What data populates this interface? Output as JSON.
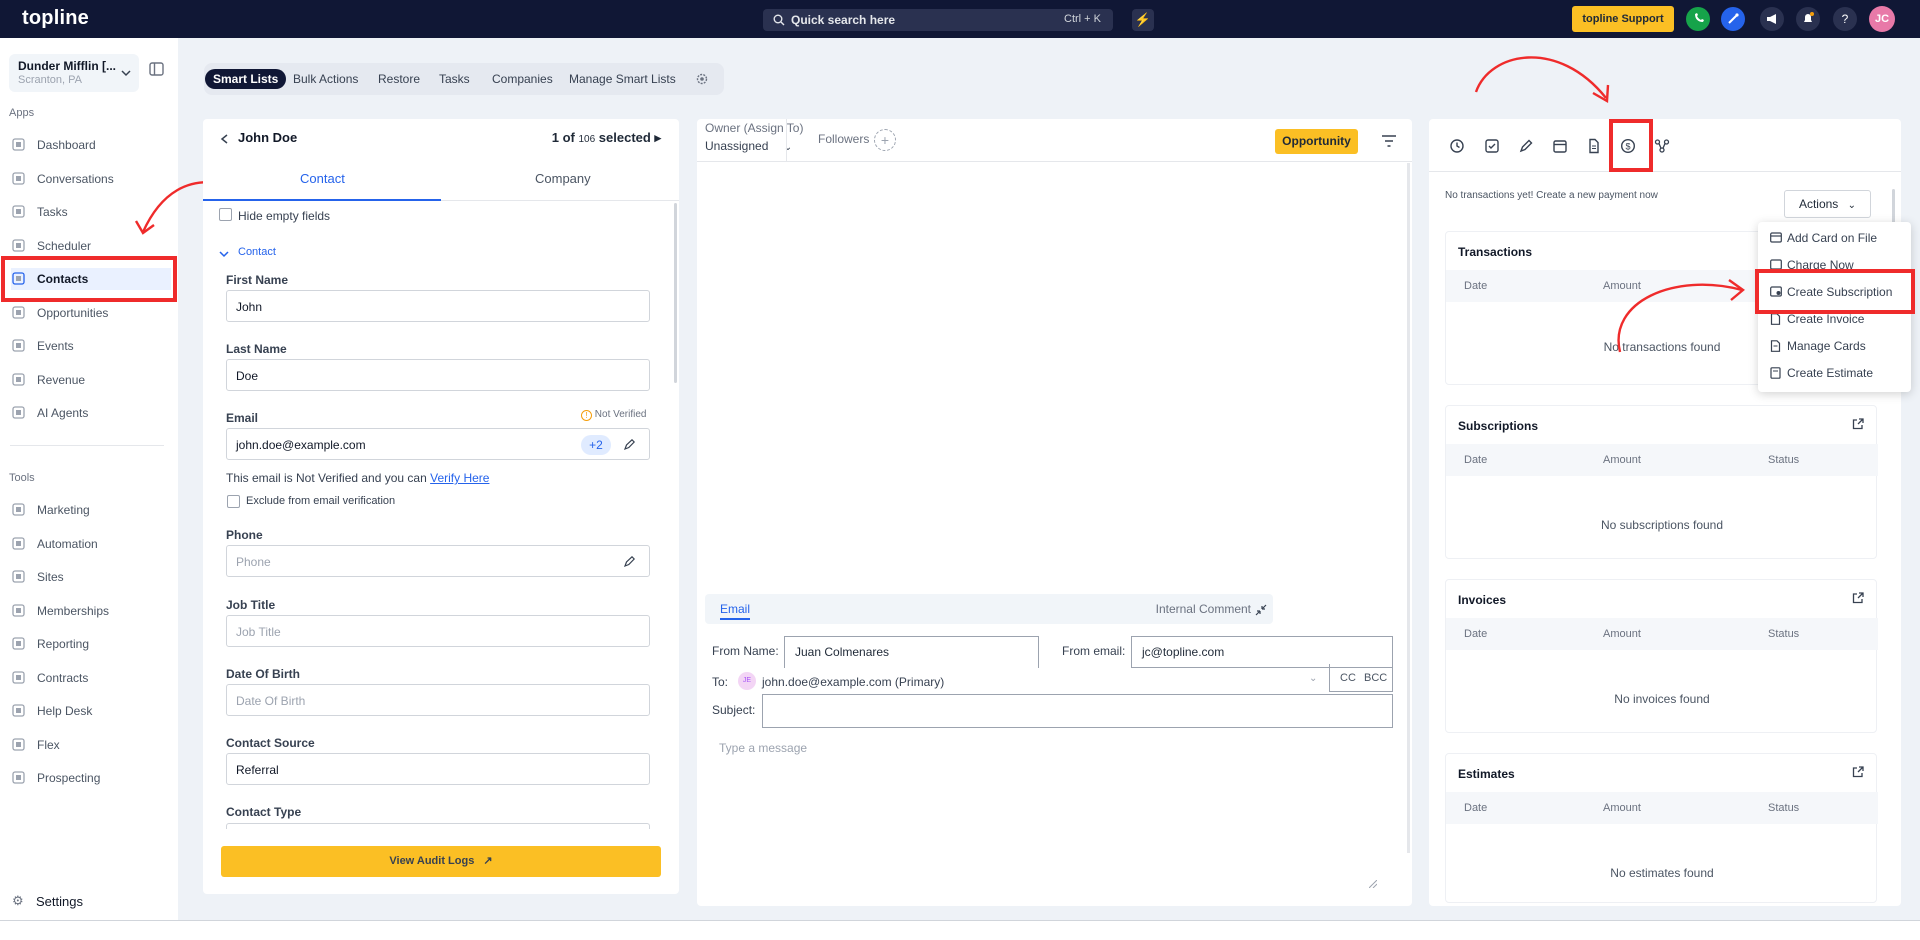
{
  "topbar": {
    "logo": "topline",
    "search_placeholder": "Quick search here",
    "search_shortcut": "Ctrl + K",
    "support_label": "topline Support",
    "avatar_initials": "JC"
  },
  "sidebar": {
    "location_name": "Dunder Mifflin [...",
    "location_city": "Scranton, PA",
    "apps_heading": "Apps",
    "apps": [
      {
        "label": "Dashboard",
        "icon": "dashboard-icon"
      },
      {
        "label": "Conversations",
        "icon": "chat-icon"
      },
      {
        "label": "Tasks",
        "icon": "tasks-icon"
      },
      {
        "label": "Scheduler",
        "icon": "calendar-icon"
      },
      {
        "label": "Contacts",
        "icon": "user-icon"
      },
      {
        "label": "Opportunities",
        "icon": "opportunities-icon"
      },
      {
        "label": "Events",
        "icon": "events-icon"
      },
      {
        "label": "Revenue",
        "icon": "revenue-icon"
      },
      {
        "label": "AI Agents",
        "icon": "sparkle-icon"
      }
    ],
    "tools_heading": "Tools",
    "tools": [
      {
        "label": "Marketing",
        "icon": "megaphone-icon"
      },
      {
        "label": "Automation",
        "icon": "automation-icon"
      },
      {
        "label": "Sites",
        "icon": "sites-icon"
      },
      {
        "label": "Memberships",
        "icon": "memberships-icon"
      },
      {
        "label": "Reporting",
        "icon": "reporting-icon"
      },
      {
        "label": "Contracts",
        "icon": "contracts-icon"
      },
      {
        "label": "Help Desk",
        "icon": "helpdesk-icon"
      },
      {
        "label": "Flex",
        "icon": "flex-icon"
      },
      {
        "label": "Prospecting",
        "icon": "prospecting-icon"
      }
    ],
    "settings_label": "Settings"
  },
  "tabs_bar": {
    "items": [
      "Smart Lists",
      "Bulk Actions",
      "Restore",
      "Tasks",
      "Companies",
      "Manage Smart Lists"
    ]
  },
  "contact_panel": {
    "name": "John Doe",
    "selected_prefix": "1 of",
    "selected_total": "106",
    "selected_suffix": "selected",
    "tab_contact": "Contact",
    "tab_company": "Company",
    "hide_empty": "Hide empty fields",
    "section": "Contact",
    "first_name_label": "First Name",
    "first_name": "John",
    "last_name_label": "Last Name",
    "last_name": "Doe",
    "email_label": "Email",
    "not_verified": "Not Verified",
    "email": "john.doe@example.com",
    "email_extra": "+2",
    "verify_text": "This email is Not Verified and you can",
    "verify_link": "Verify Here",
    "exclude_label": "Exclude from email verification",
    "phone_label": "Phone",
    "phone_placeholder": "Phone",
    "job_title_label": "Job Title",
    "job_title_placeholder": "Job Title",
    "dob_label": "Date Of Birth",
    "dob_placeholder": "Date Of Birth",
    "source_label": "Contact Source",
    "source": "Referral",
    "type_label": "Contact Type",
    "audit_label": "View Audit Logs"
  },
  "conversation": {
    "owner_label": "Owner (Assign To)",
    "owner_value": "Unassigned",
    "followers_label": "Followers",
    "opportunity_label": "Opportunity",
    "email_tab": "Email",
    "internal_comment": "Internal Comment",
    "from_name_label": "From Name:",
    "from_name": "Juan Colmenares",
    "from_email_label": "From email:",
    "from_email": "jc@topline.com",
    "to_label": "To:",
    "to_initials": "JE",
    "to_value": "john.doe@example.com (Primary)",
    "cc": "CC",
    "bcc": "BCC",
    "subject_label": "Subject:",
    "message_placeholder": "Type a message"
  },
  "payments": {
    "no_transactions_text": "No transactions yet! Create a new payment now",
    "actions_label": "Actions",
    "date_col": "Date",
    "amount_col": "Amount",
    "status_col": "Status",
    "transactions": {
      "title": "Transactions",
      "empty": "No transactions found"
    },
    "subscriptions": {
      "title": "Subscriptions",
      "empty": "No subscriptions found"
    },
    "invoices": {
      "title": "Invoices",
      "empty": "No invoices found"
    },
    "estimates": {
      "title": "Estimates",
      "empty": "No estimates found"
    },
    "menu": [
      "Add Card on File",
      "Charge Now",
      "Create Subscription",
      "Create Invoice",
      "Manage Cards",
      "Create Estimate"
    ]
  },
  "colors": {
    "accent": "#2563eb",
    "highlight": "#ef2b2b",
    "brand_yellow": "#fbbf24",
    "nav_bg": "#101735"
  }
}
